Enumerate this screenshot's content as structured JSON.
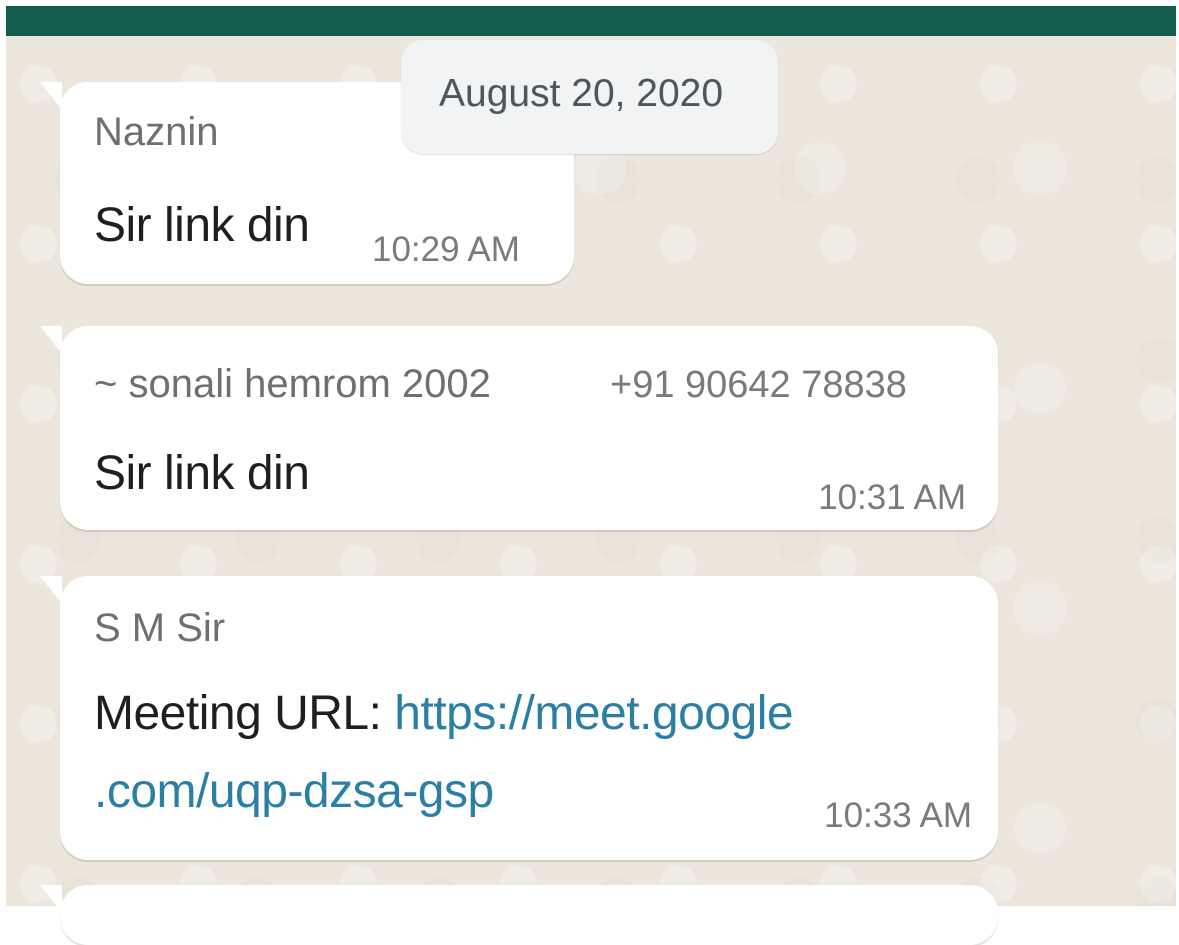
{
  "chat": {
    "date_label": "August 20, 2020",
    "messages": [
      {
        "sender": "Naznin",
        "text": "Sir link din",
        "time": "10:29 AM"
      },
      {
        "sender": "~ sonali hemrom 2002",
        "phone": "+91 90642 78838",
        "text": "Sir link din",
        "time": "10:31 AM"
      },
      {
        "sender": "S M Sir",
        "text_prefix": "Meeting URL: ",
        "link_part1": "https://meet.google",
        "link_part2": ".com/uqp-dzsa-gsp",
        "time": "10:33 AM"
      }
    ]
  },
  "colors": {
    "header": "#135c4d",
    "chat_background": "#ece6dd",
    "bubble": "#ffffff",
    "link": "#2c7fa4",
    "date_chip": "#f1f3f4"
  }
}
